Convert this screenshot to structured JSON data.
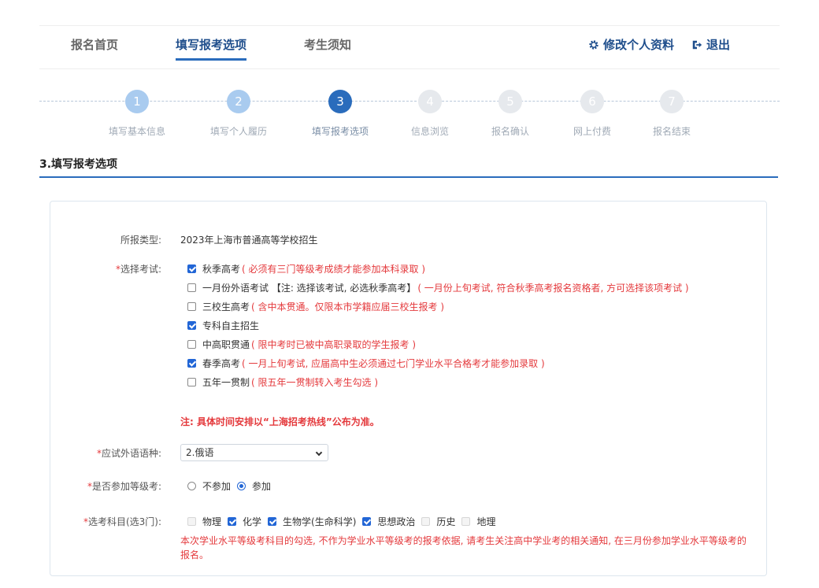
{
  "nav": {
    "home": "报名首页",
    "fill_options": "填写报考选项",
    "notice": "考生须知",
    "edit_profile": "修改个人资料",
    "logout": "退出"
  },
  "steps": [
    {
      "num": "1",
      "label": "填写基本信息",
      "state": "done"
    },
    {
      "num": "2",
      "label": "填写个人履历",
      "state": "done"
    },
    {
      "num": "3",
      "label": "填写报考选项",
      "state": "current"
    },
    {
      "num": "4",
      "label": "信息浏览",
      "state": "todo"
    },
    {
      "num": "5",
      "label": "报名确认",
      "state": "todo"
    },
    {
      "num": "6",
      "label": "网上付费",
      "state": "todo"
    },
    {
      "num": "7",
      "label": "报名结束",
      "state": "todo"
    }
  ],
  "section_title": "3.填写报考选项",
  "form": {
    "type_label": "所报类型:",
    "type_value": "2023年上海市普通高等学校招生",
    "exam_label": "选择考试:",
    "exams": [
      {
        "name": "秋季高考",
        "note": "( 必须有三门等级考成绩才能参加本科录取 )",
        "checked": true
      },
      {
        "name": "一月份外语考试 【注: 选择该考试, 必选秋季高考】",
        "note": "( 一月份上旬考试, 符合秋季高考报名资格者, 方可选择该项考试 )",
        "checked": false
      },
      {
        "name": "三校生高考",
        "note": "( 含中本贯通。仅限本市学籍应届三校生报考 )",
        "checked": false
      },
      {
        "name": "专科自主招生",
        "note": "",
        "checked": true
      },
      {
        "name": "中高职贯通",
        "note": "( 限中考时已被中高职录取的学生报考 )",
        "checked": false
      },
      {
        "name": "春季高考",
        "note": "( 一月上旬考试, 应届高中生必须通过七门学业水平合格考才能参加录取 )",
        "checked": true
      },
      {
        "name": "五年一贯制",
        "note": "( 限五年一贯制转入考生勾选 )",
        "checked": false
      }
    ],
    "schedule_note": "注: 具体时间安排以“上海招考热线”公布为准。",
    "lang_label": "应试外语语种:",
    "lang_value": "2.俄语",
    "grade_label": "是否参加等级考:",
    "grade_options": [
      {
        "label": "不参加",
        "checked": false
      },
      {
        "label": "参加",
        "checked": true
      }
    ],
    "subjects_label": "选考科目(选3门):",
    "subjects": [
      {
        "label": "物理",
        "checked": false
      },
      {
        "label": "化学",
        "checked": true
      },
      {
        "label": "生物学(生命科学)",
        "checked": true
      },
      {
        "label": "思想政治",
        "checked": true
      },
      {
        "label": "历史",
        "checked": false
      },
      {
        "label": "地理",
        "checked": false
      }
    ],
    "subjects_note": "本次学业水平等级考科目的勾选, 不作为学业水平等级考的报考依据, 请考生关注高中学业考的相关通知, 在三月份参加学业水平等级考的报名。"
  }
}
